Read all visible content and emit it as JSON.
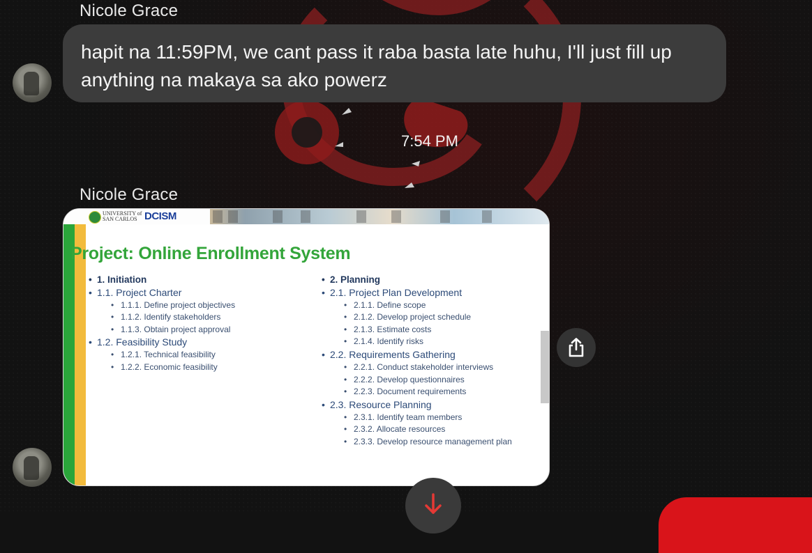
{
  "messages": [
    {
      "sender": "Nicole Grace",
      "text": "hapit na 11:59PM, we cant pass it raba basta late huhu, I'll just fill up anything na makaya sa ako powerz"
    },
    {
      "sender": "Nicole Grace",
      "attachment": {
        "slide": {
          "header_org": "UNIVERSITY of SAN CARLOS",
          "header_dept": "DCISM",
          "title": "Project: Online Enrollment System",
          "left_column": [
            {
              "level": 1,
              "text": "1. Initiation"
            },
            {
              "level": 2,
              "text": "1.1. Project Charter"
            },
            {
              "level": 3,
              "text": "1.1.1. Define project objectives"
            },
            {
              "level": 3,
              "text": "1.1.2. Identify stakeholders"
            },
            {
              "level": 3,
              "text": "1.1.3. Obtain project approval"
            },
            {
              "level": 2,
              "text": "1.2. Feasibility Study"
            },
            {
              "level": 3,
              "text": "1.2.1. Technical feasibility"
            },
            {
              "level": 3,
              "text": "1.2.2. Economic feasibility"
            }
          ],
          "right_column": [
            {
              "level": 1,
              "text": "2. Planning"
            },
            {
              "level": 2,
              "text": "2.1. Project Plan Development"
            },
            {
              "level": 3,
              "text": "2.1.1. Define scope"
            },
            {
              "level": 3,
              "text": "2.1.2. Develop project schedule"
            },
            {
              "level": 3,
              "text": "2.1.3. Estimate costs"
            },
            {
              "level": 3,
              "text": "2.1.4. Identify risks"
            },
            {
              "level": 2,
              "text": "2.2. Requirements Gathering"
            },
            {
              "level": 3,
              "text": "2.2.1. Conduct stakeholder interviews"
            },
            {
              "level": 3,
              "text": "2.2.2. Develop questionnaires"
            },
            {
              "level": 3,
              "text": "2.2.3. Document requirements"
            },
            {
              "level": 2,
              "text": "2.3. Resource Planning"
            },
            {
              "level": 3,
              "text": "2.3.1. Identify team members"
            },
            {
              "level": 3,
              "text": "2.3.2. Allocate resources"
            },
            {
              "level": 3,
              "text": "2.3.3. Develop resource management plan"
            }
          ]
        }
      }
    }
  ],
  "timestamp": "7:54 PM",
  "icons": {
    "share": "share-icon",
    "scroll_down": "arrow-down-icon"
  },
  "colors": {
    "background": "#121212",
    "bubble": "#3c3c3c",
    "slide_title": "#33a53a",
    "slide_bar_green": "#2aa53a",
    "slide_bar_yellow": "#f2bb3c",
    "accent_red": "#d9141a",
    "emblem_red": "#8e1c1c"
  }
}
